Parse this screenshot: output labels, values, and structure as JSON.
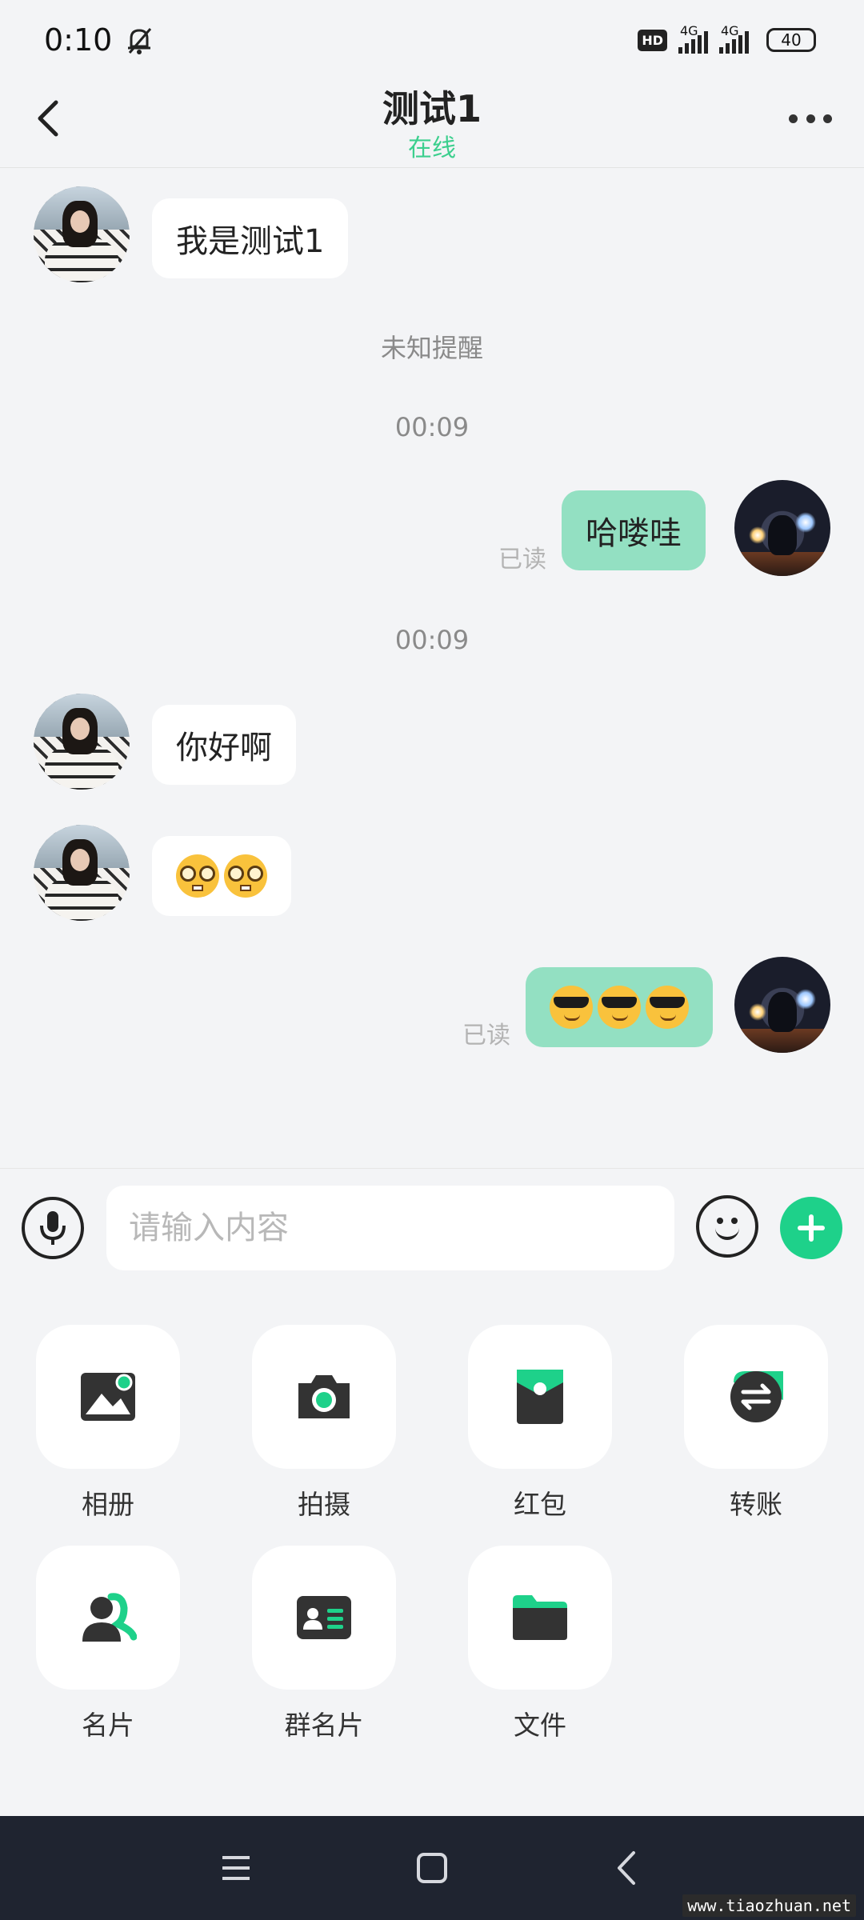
{
  "status": {
    "time": "0:10",
    "hd": "HD",
    "network1": "4G",
    "network2": "4G",
    "battery": "40"
  },
  "header": {
    "title": "测试1",
    "subtitle": "在线"
  },
  "messages": {
    "m1": "我是测试1",
    "system_notice": "未知提醒",
    "time1": "00:09",
    "m2": "哈喽哇",
    "read1": "已读",
    "time2": "00:09",
    "m3": "你好啊",
    "m4_emoji": "nerd-face x2",
    "m5_emoji": "sunglasses-face x3",
    "read2": "已读"
  },
  "input": {
    "placeholder": "请输入内容"
  },
  "tools": {
    "album": "相册",
    "camera": "拍摄",
    "red_packet": "红包",
    "transfer": "转账",
    "card": "名片",
    "group_card": "群名片",
    "file": "文件"
  },
  "colors": {
    "accent": "#1ed18a",
    "online": "#3ccf8e",
    "sent_bubble": "#93e0c2"
  },
  "watermark": "www.tiaozhuan.net"
}
